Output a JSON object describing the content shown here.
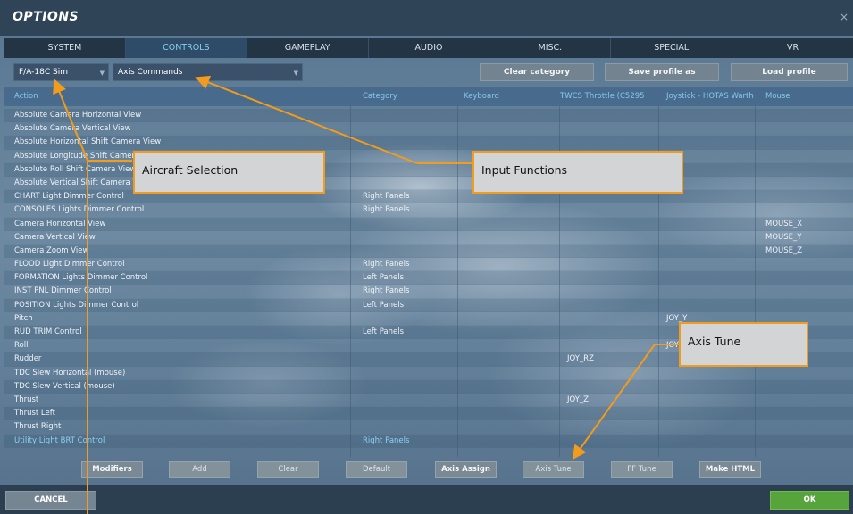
{
  "window": {
    "title": "OPTIONS",
    "close_glyph": "×"
  },
  "tabs": [
    "SYSTEM",
    "CONTROLS",
    "GAMEPLAY",
    "AUDIO",
    "MISC.",
    "SPECIAL",
    "VR"
  ],
  "active_tab": "CONTROLS",
  "toolbar": {
    "aircraft_select": "F/A-18C Sim",
    "category_select": "Axis Commands",
    "clear_category": "Clear category",
    "save_profile": "Save profile as",
    "load_profile": "Load profile"
  },
  "table": {
    "headers": [
      "Action",
      "Category",
      "Keyboard",
      "TWCS Throttle (C5295",
      "Joystick - HOTAS Warth",
      "Mouse"
    ],
    "rows": [
      {
        "action": "Absolute Camera Horizontal View",
        "category": "",
        "keyboard": "",
        "throttle": "",
        "joystick": "",
        "mouse": ""
      },
      {
        "action": "Absolute Camera Vertical View",
        "category": "",
        "keyboard": "",
        "throttle": "",
        "joystick": "",
        "mouse": ""
      },
      {
        "action": "Absolute Horizontal Shift Camera View",
        "category": "",
        "keyboard": "",
        "throttle": "",
        "joystick": "",
        "mouse": ""
      },
      {
        "action": "Absolute Longitude Shift Camera View",
        "category": "",
        "keyboard": "",
        "throttle": "",
        "joystick": "",
        "mouse": ""
      },
      {
        "action": "Absolute Roll Shift Camera View",
        "category": "",
        "keyboard": "",
        "throttle": "",
        "joystick": "",
        "mouse": ""
      },
      {
        "action": "Absolute Vertical Shift Camera View",
        "category": "",
        "keyboard": "",
        "throttle": "",
        "joystick": "",
        "mouse": ""
      },
      {
        "action": "CHART Light Dimmer Control",
        "category": "Right Panels",
        "keyboard": "",
        "throttle": "",
        "joystick": "",
        "mouse": ""
      },
      {
        "action": "CONSOLES Lights Dimmer Control",
        "category": "Right Panels",
        "keyboard": "",
        "throttle": "",
        "joystick": "",
        "mouse": ""
      },
      {
        "action": "Camera Horizontal View",
        "category": "",
        "keyboard": "",
        "throttle": "",
        "joystick": "",
        "mouse": "MOUSE_X"
      },
      {
        "action": "Camera Vertical View",
        "category": "",
        "keyboard": "",
        "throttle": "",
        "joystick": "",
        "mouse": "MOUSE_Y"
      },
      {
        "action": "Camera Zoom View",
        "category": "",
        "keyboard": "",
        "throttle": "",
        "joystick": "",
        "mouse": "MOUSE_Z"
      },
      {
        "action": "FLOOD Light Dimmer Control",
        "category": "Right Panels",
        "keyboard": "",
        "throttle": "",
        "joystick": "",
        "mouse": ""
      },
      {
        "action": "FORMATION Lights Dimmer Control",
        "category": "Left Panels",
        "keyboard": "",
        "throttle": "",
        "joystick": "",
        "mouse": ""
      },
      {
        "action": "INST PNL Dimmer Control",
        "category": "Right Panels",
        "keyboard": "",
        "throttle": "",
        "joystick": "",
        "mouse": ""
      },
      {
        "action": "POSITION Lights Dimmer Control",
        "category": "Left Panels",
        "keyboard": "",
        "throttle": "",
        "joystick": "",
        "mouse": ""
      },
      {
        "action": "Pitch",
        "category": "",
        "keyboard": "",
        "throttle": "",
        "joystick": "JOY_Y",
        "mouse": ""
      },
      {
        "action": "RUD TRIM Control",
        "category": "Left Panels",
        "keyboard": "",
        "throttle": "",
        "joystick": "",
        "mouse": ""
      },
      {
        "action": "Roll",
        "category": "",
        "keyboard": "",
        "throttle": "",
        "joystick": "JOY_X",
        "mouse": ""
      },
      {
        "action": "Rudder",
        "category": "",
        "keyboard": "",
        "throttle": "JOY_RZ",
        "joystick": "",
        "mouse": ""
      },
      {
        "action": "TDC Slew Horizontal (mouse)",
        "category": "",
        "keyboard": "",
        "throttle": "",
        "joystick": "",
        "mouse": ""
      },
      {
        "action": "TDC Slew Vertical (mouse)",
        "category": "",
        "keyboard": "",
        "throttle": "",
        "joystick": "",
        "mouse": ""
      },
      {
        "action": "Thrust",
        "category": "",
        "keyboard": "",
        "throttle": "JOY_Z",
        "joystick": "",
        "mouse": ""
      },
      {
        "action": "Thrust Left",
        "category": "",
        "keyboard": "",
        "throttle": "",
        "joystick": "",
        "mouse": ""
      },
      {
        "action": "Thrust Right",
        "category": "",
        "keyboard": "",
        "throttle": "",
        "joystick": "",
        "mouse": ""
      },
      {
        "action": "Utility Light BRT Control",
        "category": "Right Panels",
        "keyboard": "",
        "throttle": "",
        "joystick": "",
        "mouse": "",
        "highlight": true
      }
    ]
  },
  "bottom_buttons": [
    "Modifiers",
    "Add",
    "Clear",
    "Default",
    "Axis Assign",
    "Axis Tune",
    "FF Tune",
    "Make HTML"
  ],
  "footer": {
    "cancel": "CANCEL",
    "ok": "OK"
  },
  "annotations": {
    "aircraft_selection": "Aircraft Selection",
    "input_functions": "Input Functions",
    "axis_tune": "Axis Tune"
  },
  "colors": {
    "annotation_border": "#f29b1c",
    "accent_tab": "#86cff2",
    "ok_green": "#57a33c"
  }
}
